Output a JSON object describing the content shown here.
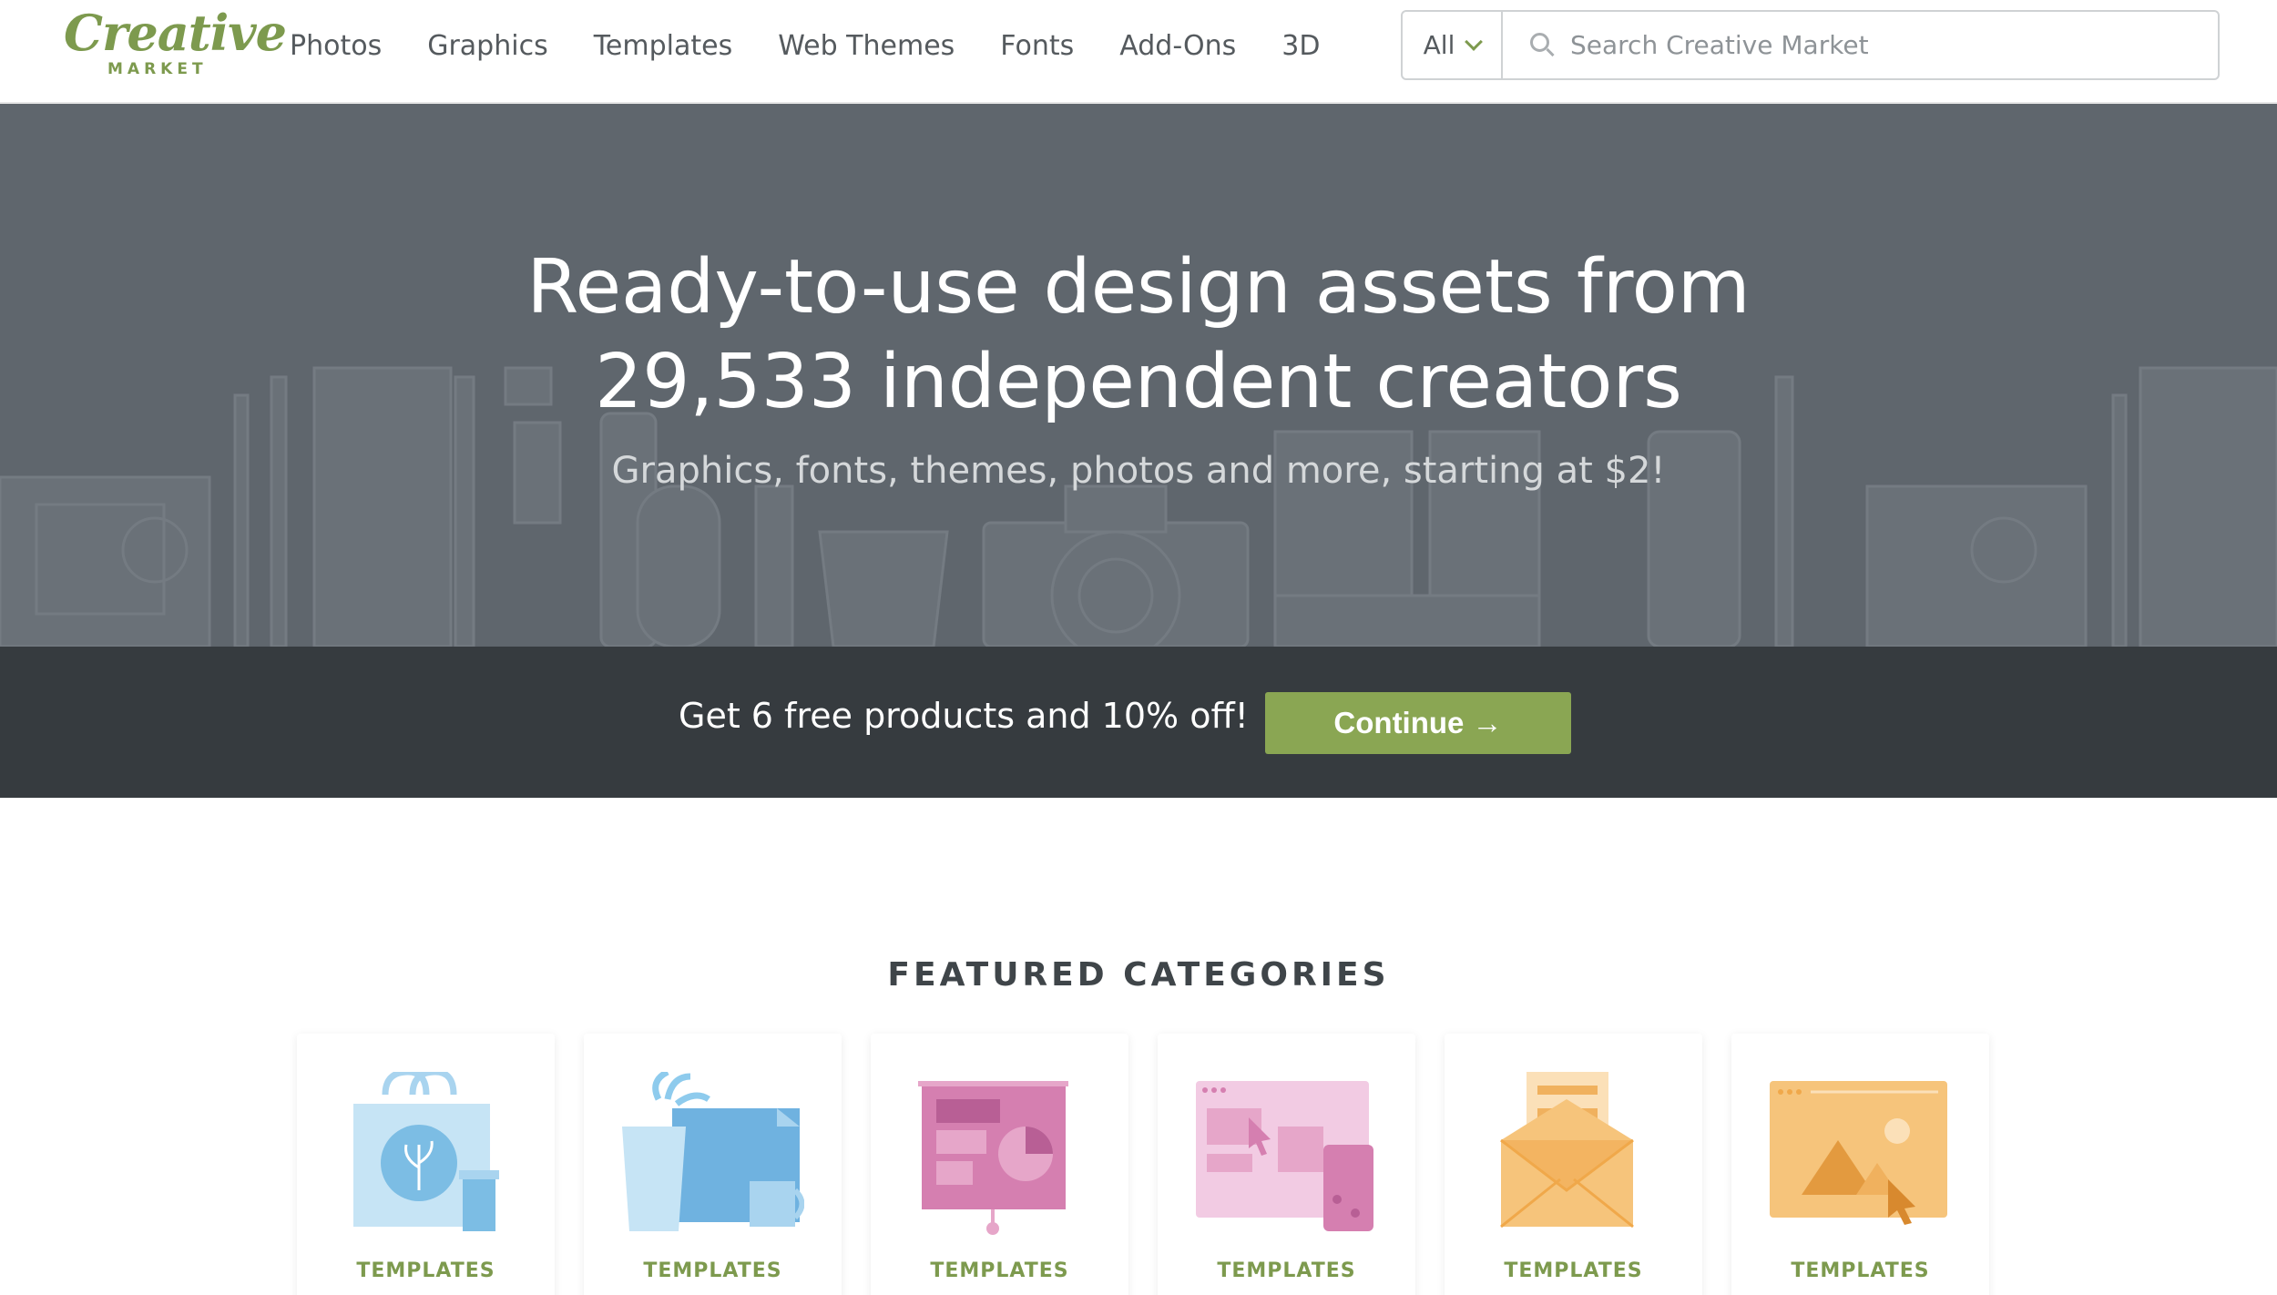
{
  "brand": {
    "logo_script": "Creative",
    "logo_sub": "MARKET",
    "accent": "#7d9a4e"
  },
  "nav": {
    "items": [
      {
        "label": "Photos"
      },
      {
        "label": "Graphics"
      },
      {
        "label": "Templates"
      },
      {
        "label": "Web Themes"
      },
      {
        "label": "Fonts"
      },
      {
        "label": "Add-Ons"
      },
      {
        "label": "3D"
      }
    ]
  },
  "search": {
    "scope": "All",
    "placeholder": "Search Creative Market",
    "value": ""
  },
  "hero": {
    "title_line1": "Ready-to-use design assets from",
    "title_line2": "29,533 independent creators",
    "subtitle": "Graphics, fonts, themes, photos and more, starting at $2!",
    "background": "#5f666d"
  },
  "promo": {
    "text": "Get 6 free products and 10% off!",
    "button_label": "Continue →",
    "button_color": "#8aa653"
  },
  "featured": {
    "heading": "FEATURED CATEGORIES",
    "cards": [
      {
        "label": "TEMPLATES",
        "icon": "shopping-bag-icon"
      },
      {
        "label": "TEMPLATES",
        "icon": "stationery-icon"
      },
      {
        "label": "TEMPLATES",
        "icon": "presentation-icon"
      },
      {
        "label": "TEMPLATES",
        "icon": "web-template-icon"
      },
      {
        "label": "TEMPLATES",
        "icon": "email-template-icon"
      },
      {
        "label": "TEMPLATES",
        "icon": "image-template-icon"
      }
    ]
  }
}
